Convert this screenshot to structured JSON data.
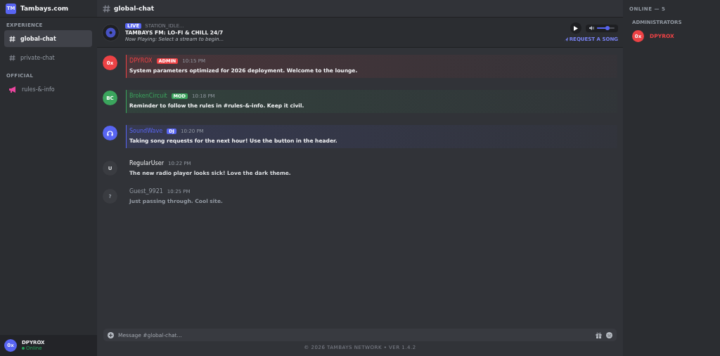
{
  "server": {
    "logo": "TM",
    "name": "Tambays.com"
  },
  "sidebar": {
    "sections": [
      {
        "title": "EXPERIENCE",
        "items": [
          {
            "label": "global-chat",
            "kind": "text",
            "selected": true
          },
          {
            "label": "private-chat",
            "kind": "text",
            "selected": false
          }
        ]
      },
      {
        "title": "OFFICIAL",
        "items": [
          {
            "label": "rules-&-info",
            "kind": "announcement",
            "selected": false
          }
        ]
      }
    ]
  },
  "user_panel": {
    "avatar": "0x",
    "name": "DPYROX",
    "status": "Online"
  },
  "channel": {
    "title": "global-chat"
  },
  "player": {
    "badge": "LIVE",
    "station": "STATION_IDLE...",
    "title": "TAMBAYS FM: LO-FI & CHILL 24/7",
    "now_playing": "Now Playing: Select a stream to begin...",
    "volume": {
      "level": 0.6
    },
    "request": "REQUEST A SONG"
  },
  "messages": [
    {
      "kind": "admin",
      "avatar": "0x",
      "author": "DPYROX",
      "badge": "ADMIN",
      "time": "10:15 PM",
      "text": "System parameters optimized for 2026 deployment. Welcome to the lounge."
    },
    {
      "kind": "mod",
      "avatar": "BC",
      "author": "BrokenCircuit",
      "badge": "MOD",
      "time": "10:18 PM",
      "text": "Reminder to follow the rules in #rules-&-info. Keep it civil."
    },
    {
      "kind": "dj",
      "author": "SoundWave",
      "badge": "DJ",
      "time": "10:20 PM",
      "text": "Taking song requests for the next hour! Use the button in the header."
    },
    {
      "kind": "member",
      "avatar": "U",
      "author": "RegularUser",
      "time": "10:22 PM",
      "text": "The new radio player looks sick! Love the dark theme."
    },
    {
      "kind": "guest",
      "avatar": "?",
      "author": "Guest_9921",
      "time": "10:25 PM",
      "text": "Just passing through. Cool site."
    }
  ],
  "composer": {
    "placeholder": "Message #global-chat..."
  },
  "footer": "© 2026 TAMBAYS NETWORK • VER 1.4.2",
  "members": {
    "title": "ONLINE — 5",
    "groups": [
      {
        "title": "ADMINISTRATORS",
        "members": [
          {
            "avatar": "0x",
            "name": "DPYROX",
            "color": "#ed4245"
          }
        ]
      }
    ]
  }
}
